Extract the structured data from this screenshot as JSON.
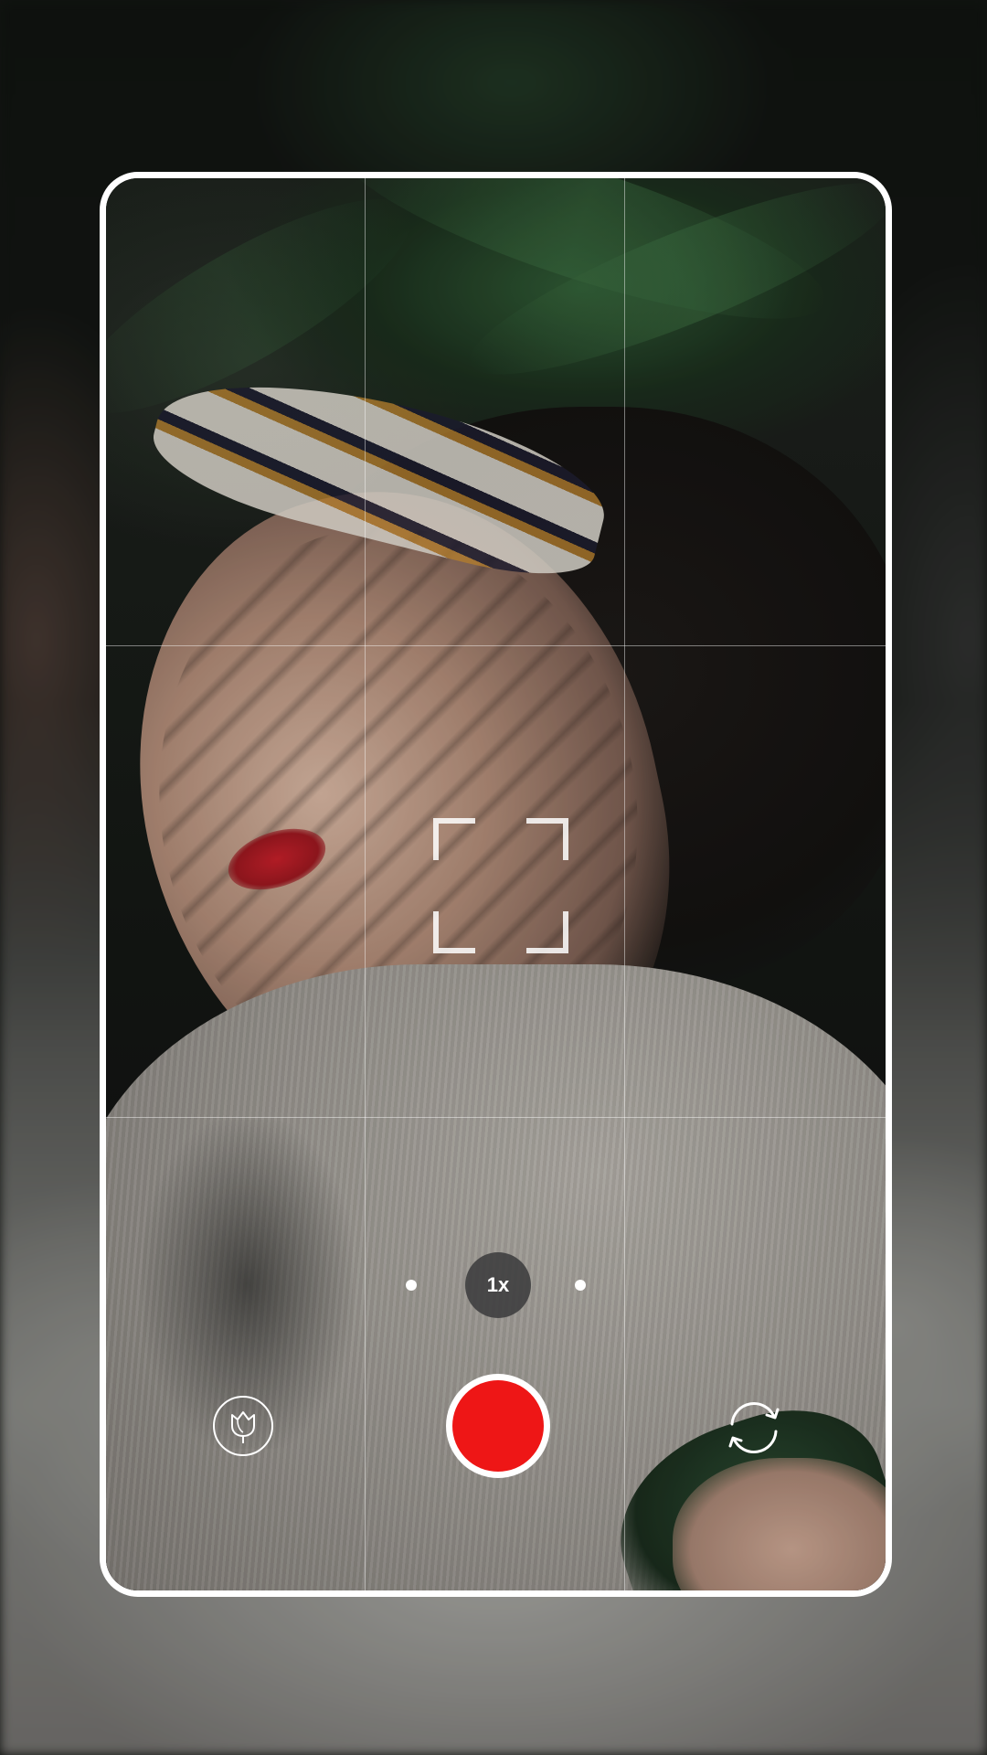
{
  "camera": {
    "zoom_label": "1x",
    "colors": {
      "record_red": "#EE1616",
      "frame_white": "#FFFFFF",
      "zoom_chip_bg": "#3C3C3E"
    }
  },
  "controls": {
    "filter_icon": "tulip-icon",
    "shutter_icon": "record-button",
    "flip_icon": "camera-flip-icon",
    "zoom_options_visible": 3,
    "zoom_selected_index": 1
  }
}
